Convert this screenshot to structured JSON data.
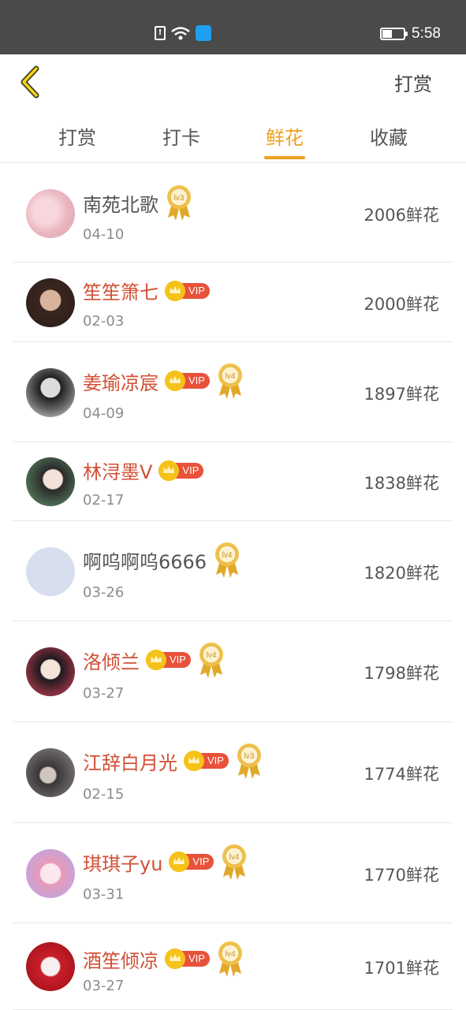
{
  "status_bar": {
    "time": "5:58",
    "battery_level": 0.45
  },
  "header": {
    "action_label": "打赏"
  },
  "tabs": [
    {
      "label": "打赏",
      "active": false
    },
    {
      "label": "打卡",
      "active": false
    },
    {
      "label": "鲜花",
      "active": true
    },
    {
      "label": "收藏",
      "active": false
    }
  ],
  "colors": {
    "accent": "#f0a020",
    "vip_name": "#d24f35",
    "vip_badge": "#e8513a",
    "crown": "#f5c21a"
  },
  "records": [
    {
      "name": "南苑北歌",
      "vip": false,
      "level": "lv3",
      "date": "04-10",
      "amount": "2006鲜花",
      "avatar": "pink"
    },
    {
      "name": "笙笙箫七",
      "vip": true,
      "level": "",
      "date": "02-03",
      "amount": "2000鲜花",
      "avatar": "girl-dark"
    },
    {
      "name": "姜瑜凉宸",
      "vip": true,
      "level": "lv4",
      "date": "04-09",
      "amount": "1897鲜花",
      "avatar": "bw"
    },
    {
      "name": "林浔墨V",
      "vip": true,
      "level": "",
      "date": "02-17",
      "amount": "1838鲜花",
      "avatar": "girl-light"
    },
    {
      "name": "啊呜啊呜6666",
      "vip": false,
      "level": "lv4",
      "date": "03-26",
      "amount": "1820鲜花",
      "avatar": "default"
    },
    {
      "name": "洛倾兰",
      "vip": true,
      "level": "lv4",
      "date": "03-27",
      "amount": "1798鲜花",
      "avatar": "anime-dark"
    },
    {
      "name": "江辞白月光",
      "vip": true,
      "level": "lv3",
      "date": "02-15",
      "amount": "1774鲜花",
      "avatar": "gray"
    },
    {
      "name": "琪琪子yu",
      "vip": true,
      "level": "lv4",
      "date": "03-31",
      "amount": "1770鲜花",
      "avatar": "anime-pink"
    },
    {
      "name": "酒笙倾凉",
      "vip": true,
      "level": "lv4",
      "date": "03-27",
      "amount": "1701鲜花",
      "avatar": "red"
    }
  ]
}
